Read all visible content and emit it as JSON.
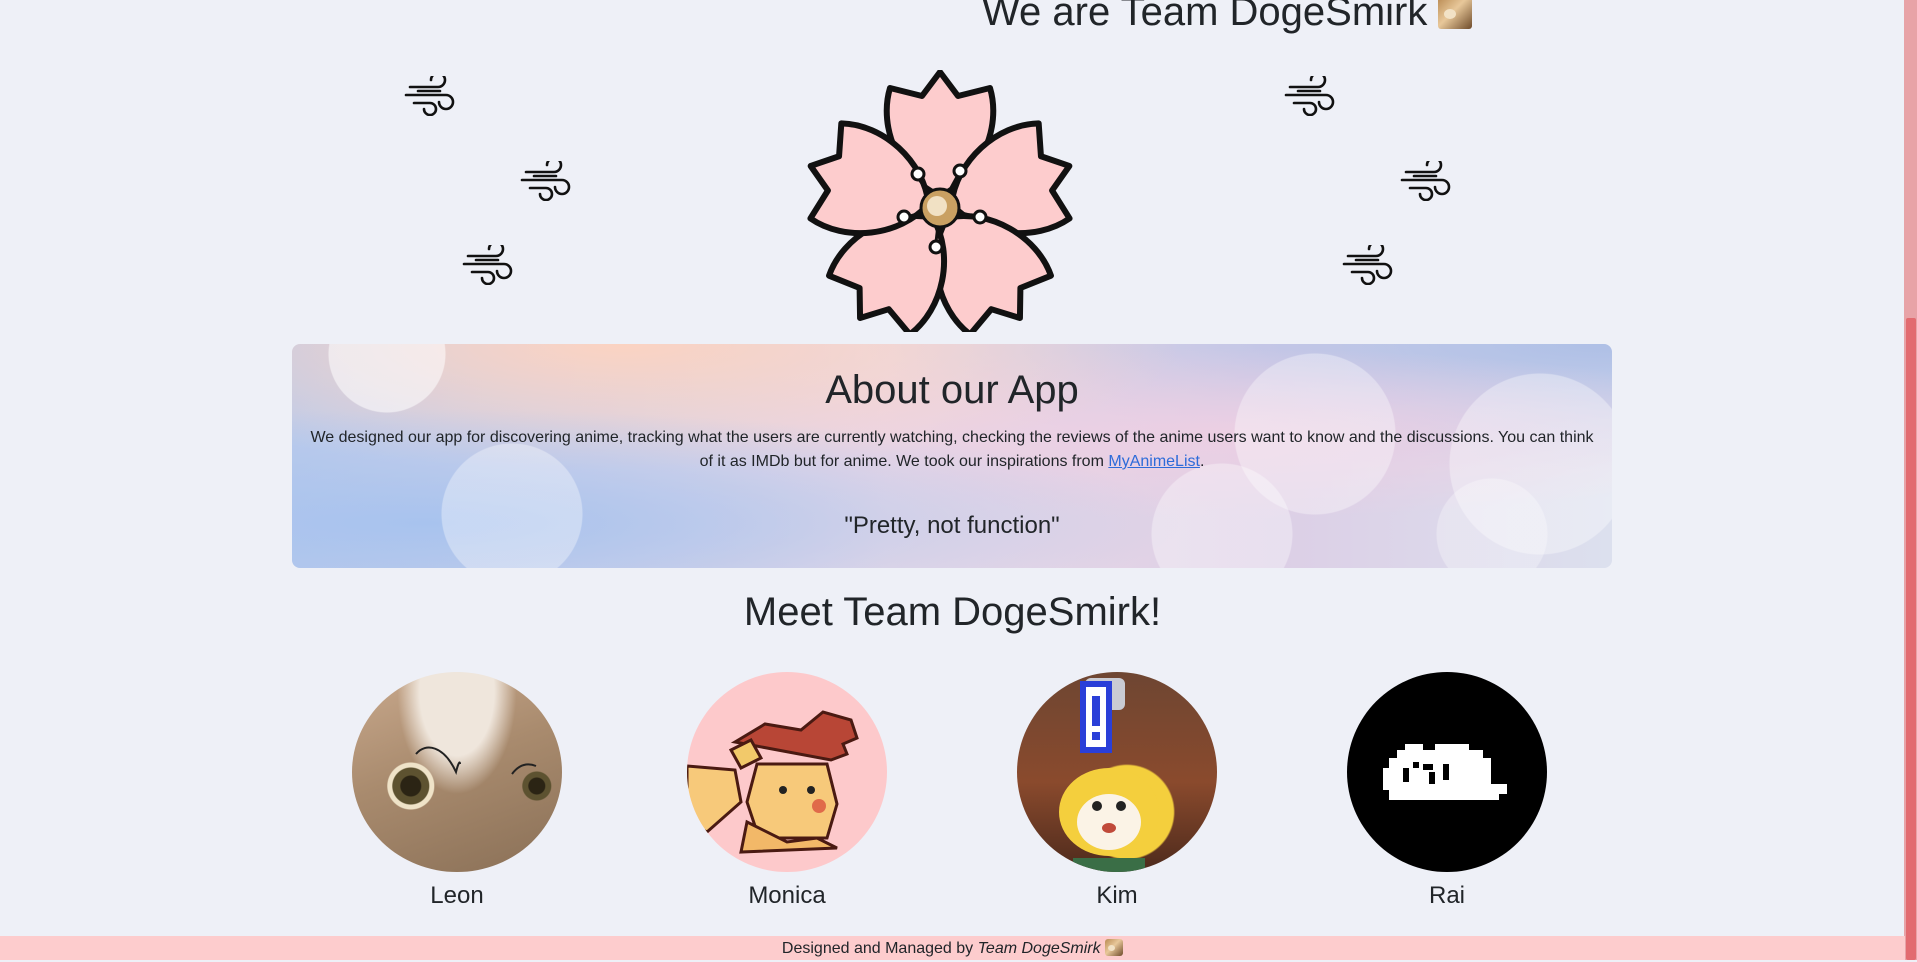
{
  "hero": {
    "title": "We are Team DogeSmirk"
  },
  "about": {
    "title": "About our App",
    "text": "We designed our app for discovering anime, tracking what the users are currently watching, checking the reviews of the anime users want to know and the discussions. You can think of it as IMDb but for anime. We took our inspirations from ",
    "link_label": "MyAnimeList",
    "text_end": ".",
    "quote": "\"Pretty, not function\""
  },
  "team": {
    "title": "Meet Team DogeSmirk!",
    "members": [
      {
        "name": "Leon"
      },
      {
        "name": "Monica"
      },
      {
        "name": "Kim"
      },
      {
        "name": "Rai"
      }
    ]
  },
  "footer": {
    "prefix": "Designed and Managed by ",
    "team": "Team DogeSmirk"
  },
  "colors": {
    "background": "#eef0f7",
    "petal": "#fdcccd",
    "footer": "#fdcccd",
    "scrollbar_thumb": "#e26b70",
    "link": "#2d6bd9"
  }
}
